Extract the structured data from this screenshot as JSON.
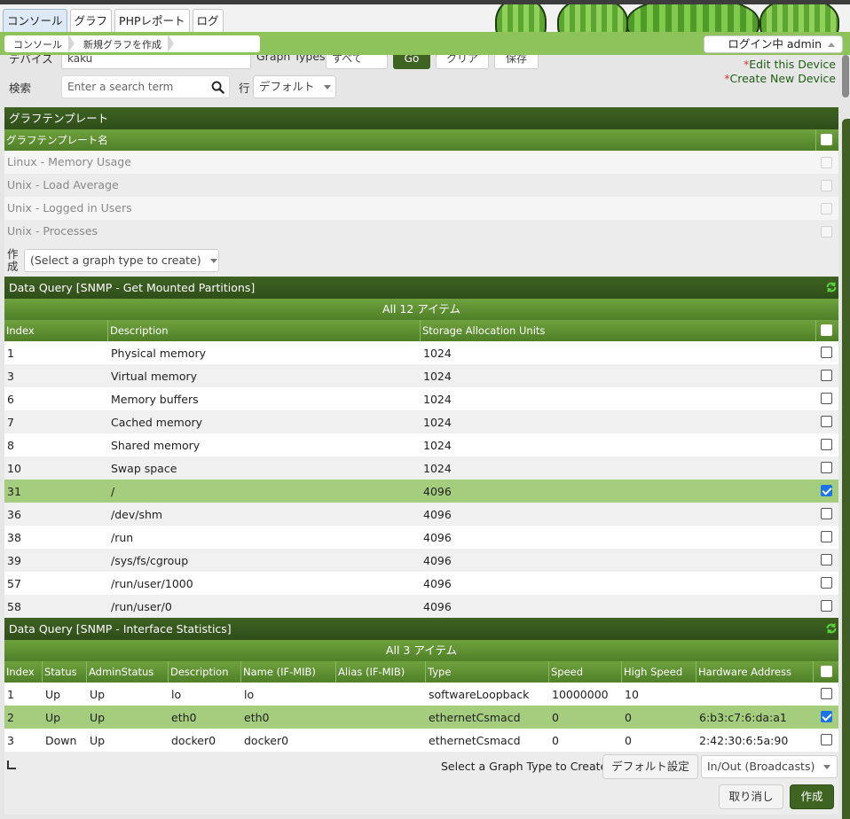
{
  "tabs": [
    "コンソール",
    "グラフ",
    "PHPレポート",
    "ログ"
  ],
  "breadcrumb": [
    "コンソール",
    "新規グラフを作成"
  ],
  "login": {
    "label": "ログイン中",
    "user": "admin"
  },
  "filter": {
    "device_label": "デバイス",
    "device_value": "kaku",
    "graph_types_label": "Graph Types",
    "graph_types_value": "すべて",
    "go_label": "Go",
    "clear_label": "クリア",
    "save_label": "保存",
    "search_label": "検索",
    "search_placeholder": "Enter a search term",
    "rows_label": "行",
    "rows_value": "デフォルト"
  },
  "links": {
    "edit_device": "Edit this Device",
    "create_device": "Create New Device",
    "star": "*"
  },
  "graph_templates": {
    "title": "グラフテンプレート",
    "column": "グラフテンプレート名",
    "rows": [
      "Linux - Memory Usage",
      "Unix - Load Average",
      "Unix - Logged in Users",
      "Unix - Processes"
    ],
    "create_label": "作成",
    "create_select": "(Select a graph type to create)"
  },
  "dq1": {
    "title": "Data Query [SNMP - Get Mounted Partitions]",
    "summary": "All 12 アイテム",
    "columns": [
      "Index",
      "Description",
      "Storage Allocation Units"
    ],
    "rows": [
      {
        "index": "1",
        "desc": "Physical memory",
        "units": "1024",
        "checked": false
      },
      {
        "index": "3",
        "desc": "Virtual memory",
        "units": "1024",
        "checked": false
      },
      {
        "index": "6",
        "desc": "Memory buffers",
        "units": "1024",
        "checked": false
      },
      {
        "index": "7",
        "desc": "Cached memory",
        "units": "1024",
        "checked": false
      },
      {
        "index": "8",
        "desc": "Shared memory",
        "units": "1024",
        "checked": false
      },
      {
        "index": "10",
        "desc": "Swap space",
        "units": "1024",
        "checked": false
      },
      {
        "index": "31",
        "desc": "/",
        "units": "4096",
        "checked": true
      },
      {
        "index": "36",
        "desc": "/dev/shm",
        "units": "4096",
        "checked": false
      },
      {
        "index": "38",
        "desc": "/run",
        "units": "4096",
        "checked": false
      },
      {
        "index": "39",
        "desc": "/sys/fs/cgroup",
        "units": "4096",
        "checked": false
      },
      {
        "index": "57",
        "desc": "/run/user/1000",
        "units": "4096",
        "checked": false
      },
      {
        "index": "58",
        "desc": "/run/user/0",
        "units": "4096",
        "checked": false
      }
    ]
  },
  "dq2": {
    "title": "Data Query [SNMP - Interface Statistics]",
    "summary": "All 3 アイテム",
    "columns": [
      "Index",
      "Status",
      "AdminStatus",
      "Description",
      "Name (IF-MIB)",
      "Alias (IF-MIB)",
      "Type",
      "Speed",
      "High Speed",
      "Hardware Address"
    ],
    "rows": [
      {
        "cells": [
          "1",
          "Up",
          "Up",
          "lo",
          "lo",
          "",
          "softwareLoopback",
          "10000000",
          "10",
          ""
        ],
        "checked": false
      },
      {
        "cells": [
          "2",
          "Up",
          "Up",
          "eth0",
          "eth0",
          "",
          "ethernetCsmacd",
          "0",
          "0",
          "6:b3:c7:6:da:a1"
        ],
        "checked": true
      },
      {
        "cells": [
          "3",
          "Down",
          "Up",
          "docker0",
          "docker0",
          "",
          "ethernetCsmacd",
          "0",
          "0",
          "2:42:30:6:5a:90"
        ],
        "checked": false
      }
    ],
    "footer_label": "Select a Graph Type to Create",
    "default_btn": "デフォルト設定",
    "graph_select": "In/Out (Broadcasts)"
  },
  "actions": {
    "cancel": "取り消し",
    "create": "作成"
  },
  "colors": {
    "dark_green": "#2f4e19",
    "mid_green": "#5f912f",
    "selected_row": "#a4cd7d",
    "checkbox_blue": "#1a73e8"
  }
}
